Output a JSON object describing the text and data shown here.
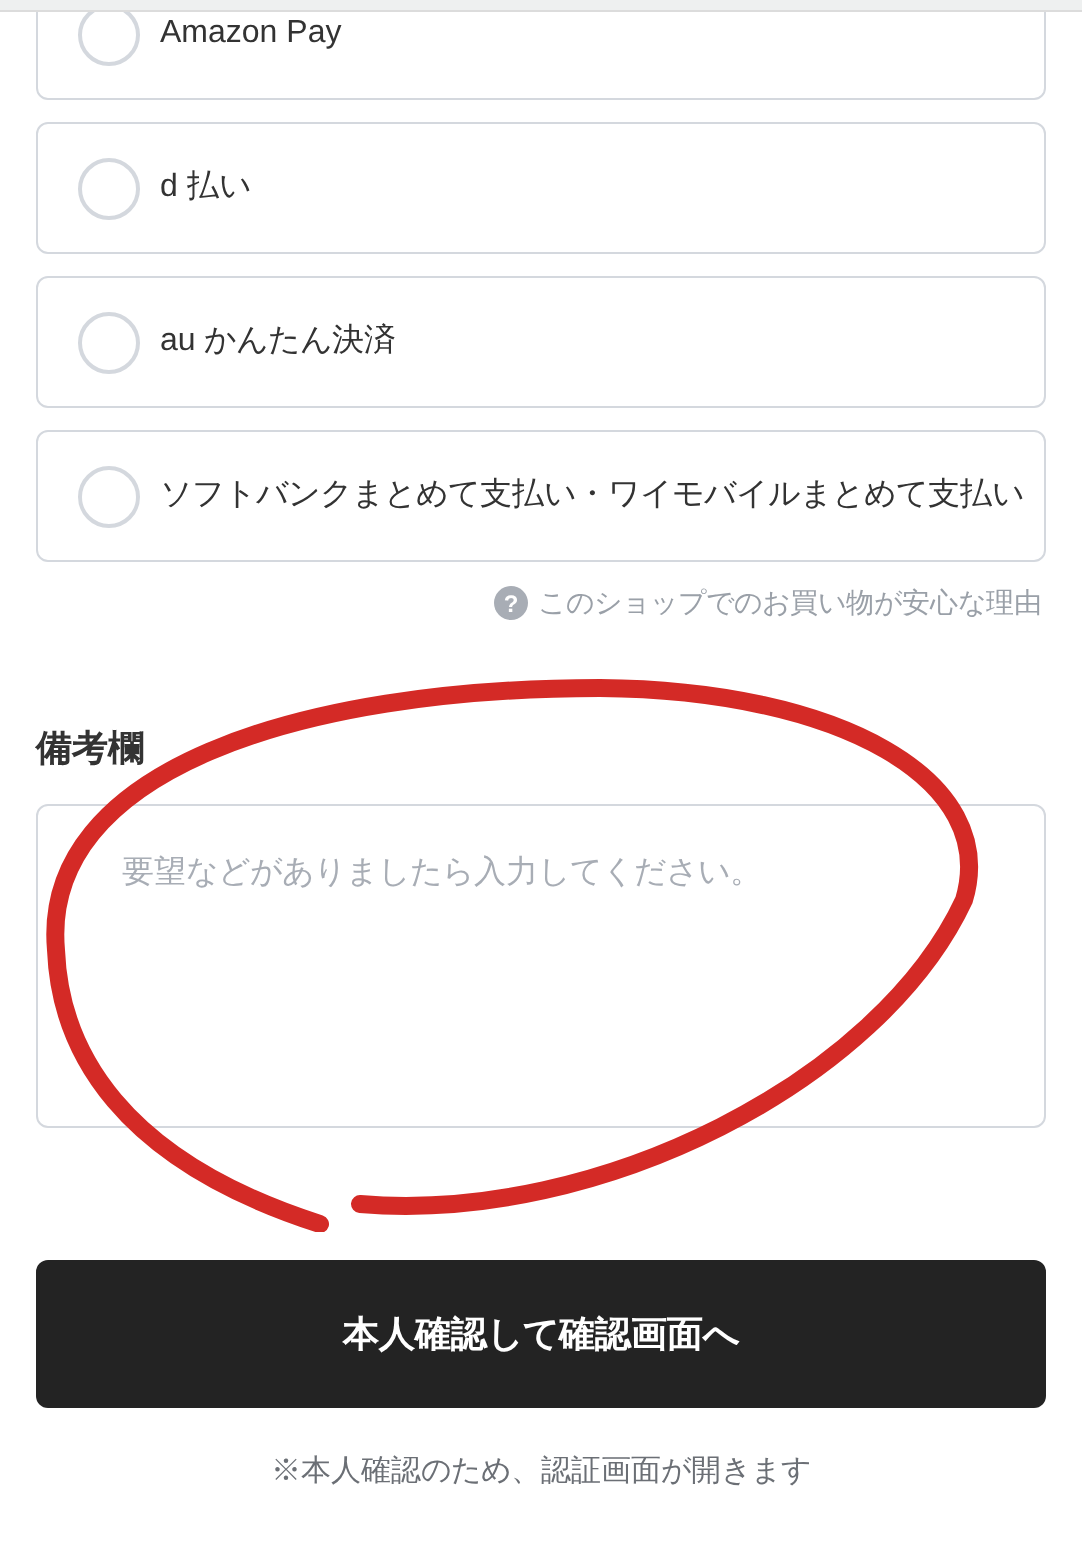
{
  "payment_options": [
    {
      "label": "Amazon Pay",
      "selected": false
    },
    {
      "label": "d 払い",
      "selected": false
    },
    {
      "label": "au かんたん決済",
      "selected": false
    },
    {
      "label": "ソフトバンクまとめて支払い・ワイモバイルまとめて支払い",
      "selected": false
    }
  ],
  "help_link": {
    "icon": "?",
    "label": "このショップでのお買い物が安心な理由"
  },
  "remarks": {
    "heading": "備考欄",
    "placeholder": "要望などがありましたら入力してください。"
  },
  "submit_button": "本人確認して確認画面へ",
  "note": "※本人確認のため、認証画面が開きます"
}
